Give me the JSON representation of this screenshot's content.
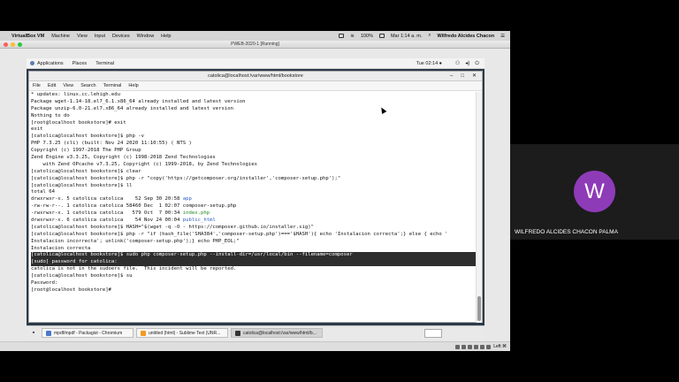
{
  "mac_menubar": {
    "app": "VirtualBox VM",
    "items": [
      "Machine",
      "View",
      "Input",
      "Devices",
      "Window",
      "Help"
    ],
    "battery": "100%",
    "datetime": "Mar 1:14 a. m.",
    "user": "Wilfredo Alcides Chacon"
  },
  "vm_window": {
    "title": "PWEB-2020-1 [Running]"
  },
  "gnome_panel": {
    "applications": "Applications",
    "places": "Places",
    "terminal": "Terminal",
    "clock": "Tue 02:14 ●"
  },
  "terminal": {
    "title": "catolica@localhost:/var/www/html/bookstore",
    "menu": [
      "File",
      "Edit",
      "View",
      "Search",
      "Terminal",
      "Help"
    ],
    "lines": [
      {
        "text": "* updates: linux.cc.lehigh.edu"
      },
      {
        "text": "Package wget-1.14-18.el7_6.1.x86_64 already installed and latest version"
      },
      {
        "text": "Package unzip-6.0-21.el7.x86_64 already installed and latest version"
      },
      {
        "text": "Nothing to do"
      },
      {
        "text": "[root@localhost bookstore]# exit"
      },
      {
        "text": "exit"
      },
      {
        "text": "[catolica@localhost bookstore]$ php -v"
      },
      {
        "text": "PHP 7.3.25 (cli) (built: Nov 24 2020 11:10:55) ( NTS )"
      },
      {
        "text": "Copyright (c) 1997-2018 The PHP Group"
      },
      {
        "text": "Zend Engine v3.3.25, Copyright (c) 1998-2018 Zend Technologies"
      },
      {
        "text": "    with Zend OPcache v7.3.25, Copyright (c) 1999-2018, by Zend Technologies"
      },
      {
        "text": "[catolica@localhost bookstore]$ clear"
      },
      {
        "text": "[catolica@localhost bookstore]$ php -r \"copy('https://getcomposer.org/installer','composer-setup.php');\""
      },
      {
        "text": "[catolica@localhost bookstore]$ ll"
      },
      {
        "text": "total 64"
      },
      {
        "text": "drwxrwxr-x. 5 catolica catolica    52 Sep 30 20:58 ",
        "tail": "app",
        "tail_color": "blue"
      },
      {
        "text": "-rw-rw-r--. 1 catolica catolica 58460 Dec  1 02:07 composer-setup.php"
      },
      {
        "text": "-rwxrwxr-x. 1 catolica catolica   579 Oct  7 00:34 ",
        "tail": "index.php",
        "tail_color": "green"
      },
      {
        "text": "drwxrwxr-x. 6 catolica catolica    54 Nov 24 00:04 ",
        "tail": "public_html",
        "tail_color": "blue"
      },
      {
        "text": "[catolica@localhost bookstore]$ HASH=\"$(wget -q -O - https://composer.github.io/installer.sig)\""
      },
      {
        "text": "[catolica@localhost bookstore]$ php -r \"if (hash_file('SHA384','composer-setup.php')==='$HASH'){ echo 'Instalacion correcta';} else { echo '"
      },
      {
        "text": "Instalacion incorrecta'; unlink('composer-setup.php');} echo PHP_EOL;\""
      },
      {
        "text": "Instalacion correcta"
      },
      {
        "text": "[catolica@localhost bookstore]$ sudo ",
        "sel": "php composer-setup.php --install-dir=/usr/local/bin --filename=composer",
        "highlight": true
      },
      {
        "text": "[sudo] password for catolica:",
        "highlight": true
      },
      {
        "text": "catolica is not in the sudoers file.  This incident will be reported."
      },
      {
        "text": "[catolica@localhost bookstore]$ su"
      },
      {
        "text": "Password:"
      },
      {
        "text": "[root@localhost bookstore]#"
      }
    ]
  },
  "taskbar": {
    "tasks": [
      {
        "label": "mpdf/mpdf - Packagist - Chromium",
        "icon_color": "#4a78c9"
      },
      {
        "label": "untitled (html) - Sublime Text (UNR...",
        "icon_color": "#f39a1e"
      },
      {
        "label": "catolica@localhost:/var/www/html/b...",
        "icon_color": "#333333"
      }
    ]
  },
  "vm_status": {
    "host_key": "Left ⌘"
  },
  "participant": {
    "initial": "W",
    "name": "WILFREDO ALCIDES CHACON PALMA",
    "avatar_color": "#8e3bb8"
  }
}
